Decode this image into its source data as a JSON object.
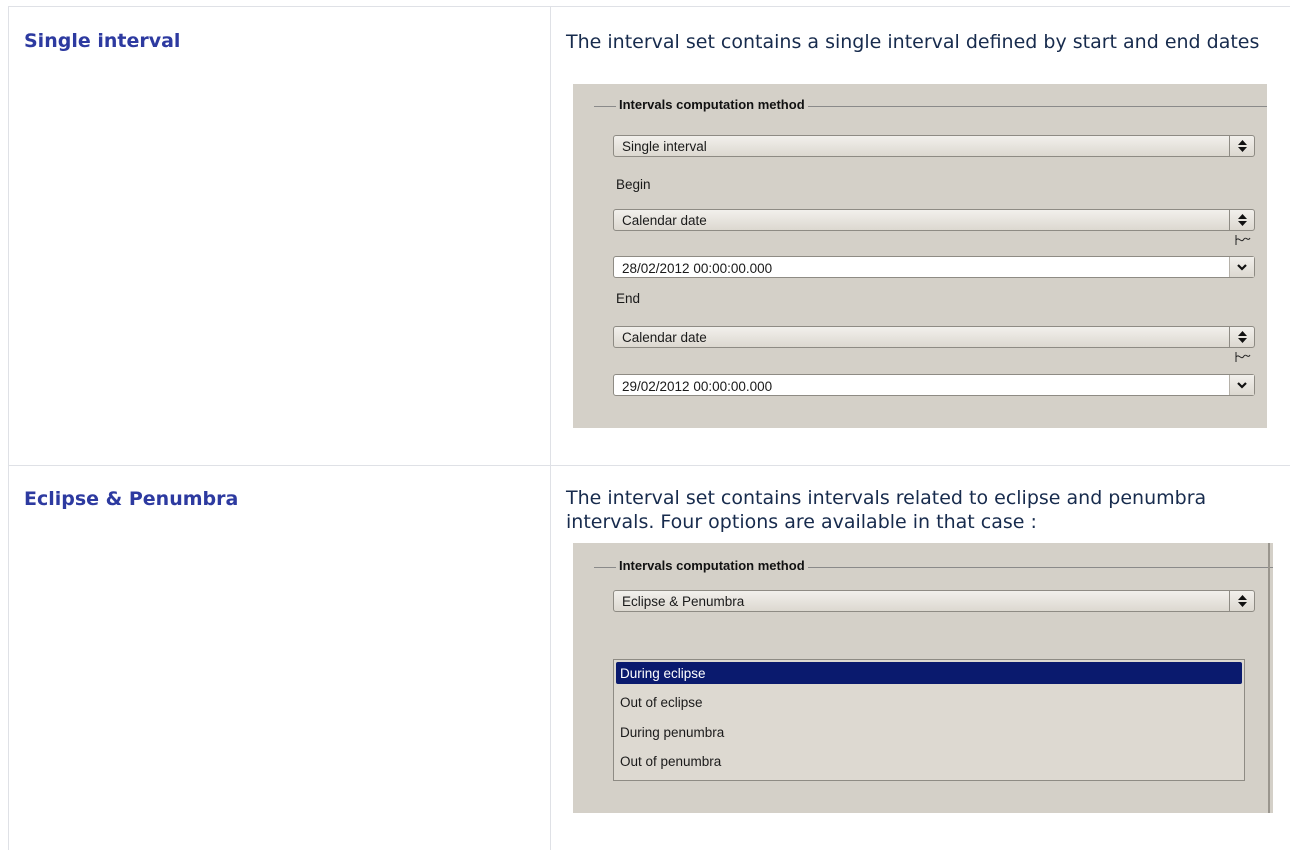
{
  "rows": [
    {
      "term": "Single interval",
      "description": "The interval set contains a single interval defined by start and end dates",
      "panel": {
        "legend": "Intervals computation method",
        "method_value": "Single interval",
        "begin_label": "Begin",
        "begin_type": "Calendar date",
        "begin_date": "28/02/2012 00:00:00.000",
        "end_label": "End",
        "end_type": "Calendar date",
        "end_date": "29/02/2012 00:00:00.000"
      }
    },
    {
      "term": "Eclipse & Penumbra",
      "description": "The interval set contains intervals related to eclipse and penumbra intervals. Four options are available in that case :",
      "panel": {
        "legend": "Intervals computation method",
        "method_value": "Eclipse & Penumbra",
        "options": [
          "During eclipse",
          "Out of eclipse",
          "During penumbra",
          "Out of penumbra"
        ],
        "selected_option": "During eclipse"
      }
    }
  ],
  "colors": {
    "term": "#2d3aa0",
    "panel_bg": "#d4d0c8",
    "selection": "#0a1a6e",
    "grid": "#dfe1e6"
  },
  "icons": {
    "combo_arrow": "updown-arrows-icon",
    "dropdown_arrow": "chevron-down-icon",
    "date_tool": "curve-icon"
  }
}
